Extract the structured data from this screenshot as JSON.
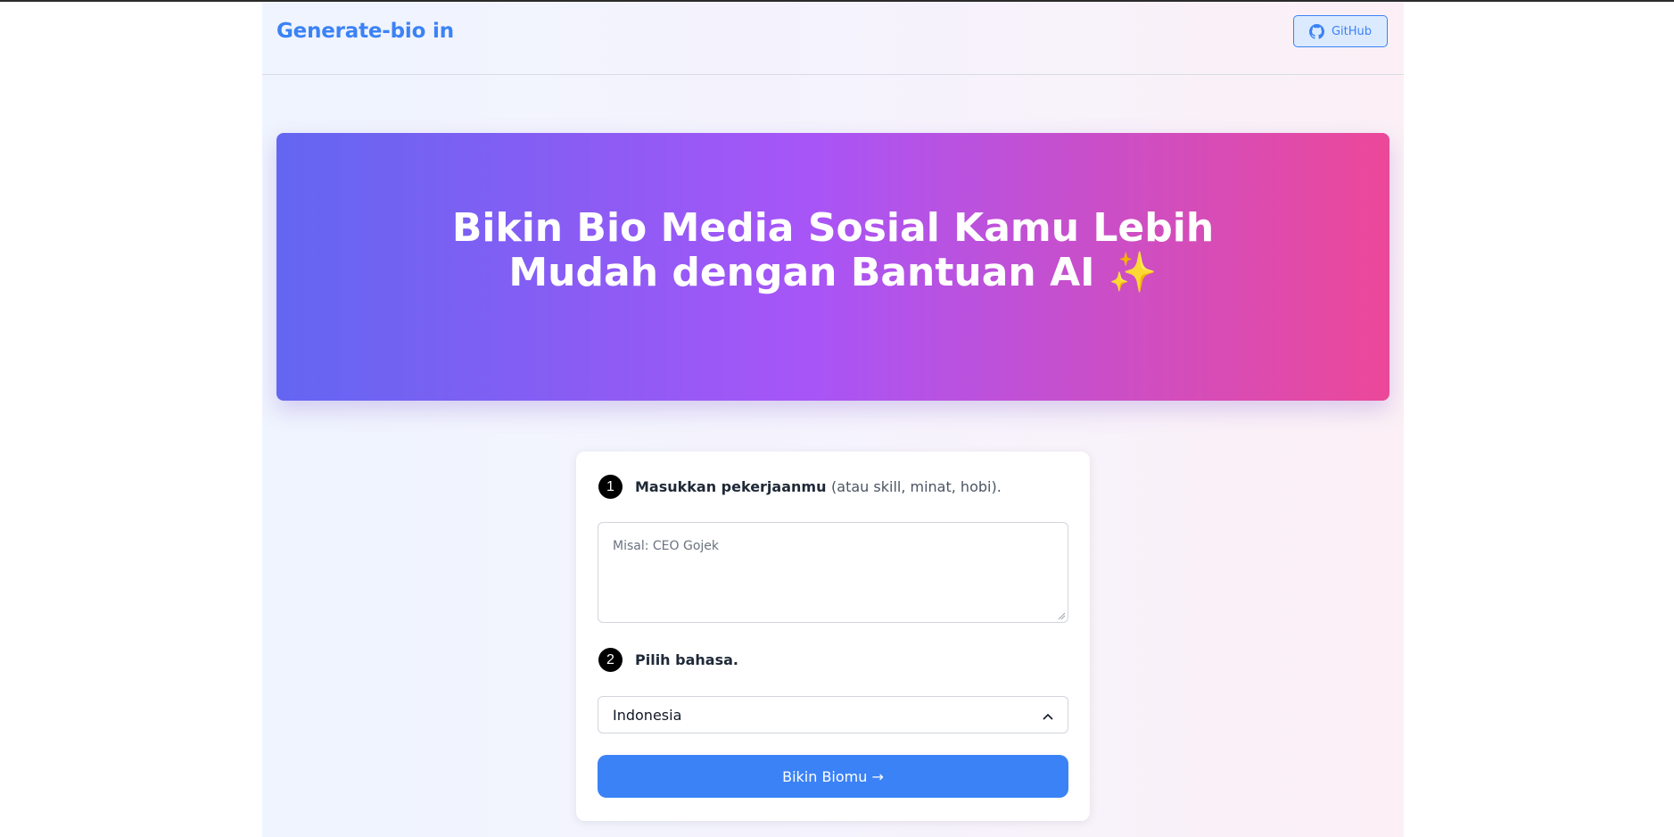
{
  "header": {
    "brand": "Generate-bio in",
    "github_label": "GitHub"
  },
  "hero": {
    "title": "Bikin Bio Media Sosial Kamu Lebih Mudah dengan Bantuan AI ✨"
  },
  "form": {
    "step1": {
      "number": "1",
      "label": "Masukkan pekerjaanmu",
      "hint": "(atau skill, minat, hobi)."
    },
    "textarea_placeholder": "Misal: CEO Gojek",
    "step2": {
      "number": "2",
      "label": "Pilih bahasa."
    },
    "language_selected": "Indonesia",
    "submit_label": "Bikin Biomu →"
  },
  "colors": {
    "accent": "#3b82f6",
    "hero_gradient": [
      "#6366f1",
      "#a855f7",
      "#ec4899"
    ]
  },
  "icons": {
    "github": "github-icon",
    "select": "chevron-up-icon"
  }
}
